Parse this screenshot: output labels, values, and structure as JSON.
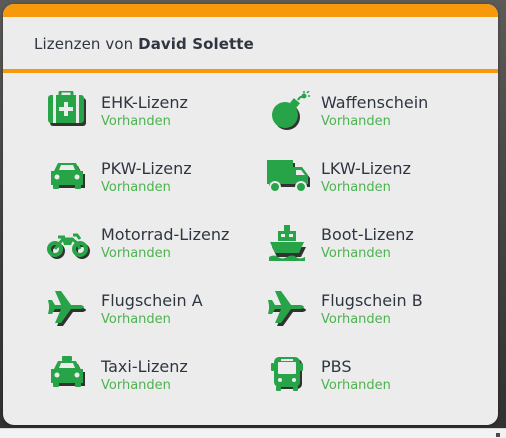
{
  "panel": {
    "title_prefix": "Lizenzen von",
    "owner": "David Solette",
    "accent_color": "#f69a0b",
    "icon_color": "#27a447",
    "status_color": "#4db34f"
  },
  "licenses": [
    {
      "name": "EHK-Lizenz",
      "status": "Vorhanden",
      "icon": "first-aid-kit-icon"
    },
    {
      "name": "Waffenschein",
      "status": "Vorhanden",
      "icon": "bomb-icon"
    },
    {
      "name": "PKW-Lizenz",
      "status": "Vorhanden",
      "icon": "car-icon"
    },
    {
      "name": "LKW-Lizenz",
      "status": "Vorhanden",
      "icon": "truck-icon"
    },
    {
      "name": "Motorrad-Lizenz",
      "status": "Vorhanden",
      "icon": "motorcycle-icon"
    },
    {
      "name": "Boot-Lizenz",
      "status": "Vorhanden",
      "icon": "ship-icon"
    },
    {
      "name": "Flugschein A",
      "status": "Vorhanden",
      "icon": "plane-icon"
    },
    {
      "name": "Flugschein B",
      "status": "Vorhanden",
      "icon": "plane-icon"
    },
    {
      "name": "Taxi-Lizenz",
      "status": "Vorhanden",
      "icon": "taxi-icon"
    },
    {
      "name": "PBS",
      "status": "Vorhanden",
      "icon": "bus-icon"
    }
  ]
}
